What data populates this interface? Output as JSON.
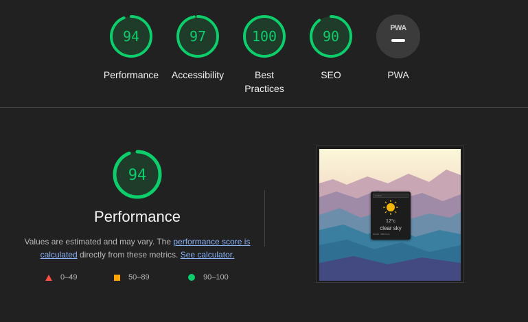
{
  "categories": [
    {
      "key": "performance",
      "score": "94",
      "label": "Performance"
    },
    {
      "key": "accessibility",
      "score": "97",
      "label": "Accessibility"
    },
    {
      "key": "best-practices",
      "score": "100",
      "label": "Best Practices"
    },
    {
      "key": "seo",
      "score": "90",
      "label": "SEO"
    },
    {
      "key": "pwa",
      "badge": "PWA",
      "label": "PWA"
    }
  ],
  "performance_detail": {
    "score": "94",
    "title": "Performance",
    "desc_prefix": "Values are estimated and may vary. The ",
    "link_score": "performance score is calculated",
    "desc_middle": " directly from these metrics. ",
    "link_calc": "See calculator."
  },
  "legend": {
    "fail": "0–49",
    "average": "50–89",
    "pass": "90–100"
  },
  "screenshot": {
    "search_placeholder": "location",
    "temperature": "12°c",
    "condition": "clear sky",
    "footer_text": "6 km/h · 68% hum"
  },
  "colors": {
    "pass": "#0cce6b",
    "average": "#ffa400",
    "fail": "#ff4e42",
    "background": "#212121"
  }
}
